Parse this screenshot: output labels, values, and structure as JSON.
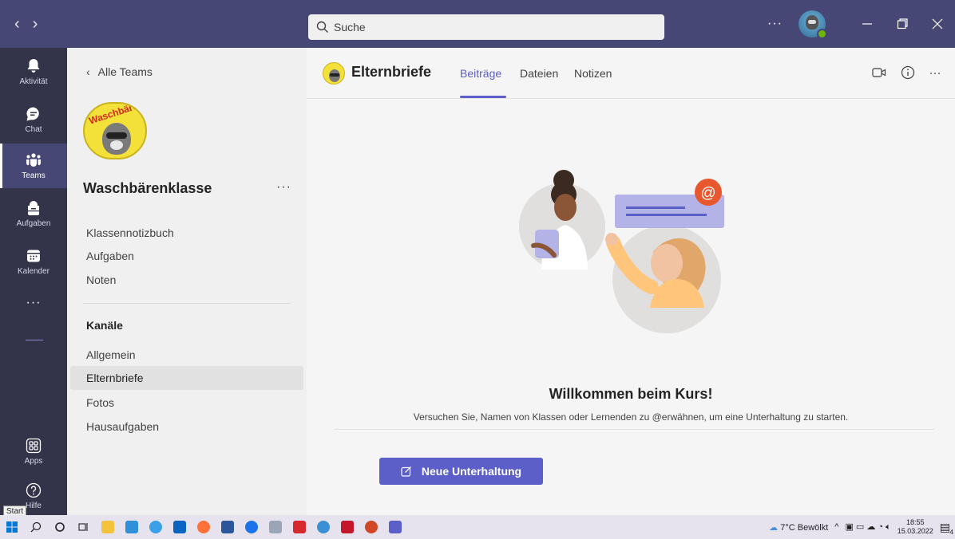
{
  "titlebar": {
    "search_placeholder": "Suche",
    "more_label": "···"
  },
  "rail": {
    "items": [
      {
        "label": "Aktivität",
        "icon": "bell-icon"
      },
      {
        "label": "Chat",
        "icon": "chat-icon"
      },
      {
        "label": "Teams",
        "icon": "teams-icon",
        "active": true
      },
      {
        "label": "Aufgaben",
        "icon": "assignments-icon"
      },
      {
        "label": "Kalender",
        "icon": "calendar-icon"
      }
    ],
    "more_label": "···",
    "apps_label": "Apps",
    "help_label": "Hilfe",
    "start_tooltip": "Start"
  },
  "team_pane": {
    "back_label": "Alle Teams",
    "logo_text": "Waschbären",
    "team_name": "Waschbärenklasse",
    "more_label": "···",
    "links": [
      "Klassennotizbuch",
      "Aufgaben",
      "Noten"
    ],
    "channels_heading": "Kanäle",
    "channels": [
      "Allgemein",
      "Elternbriefe",
      "Fotos",
      "Hausaufgaben"
    ],
    "selected_channel": "Elternbriefe"
  },
  "channel": {
    "title": "Elternbriefe",
    "tabs": [
      "Beiträge",
      "Dateien",
      "Notizen"
    ],
    "active_tab": "Beiträge",
    "more_label": "···"
  },
  "welcome": {
    "title": "Willkommen beim Kurs!",
    "subtitle": "Versuchen Sie, Namen von Klassen oder Lernenden zu @erwähnen, um eine Unterhaltung zu starten.",
    "button_label": "Neue Unterhaltung"
  },
  "taskbar": {
    "weather": "7°C Bewölkt",
    "time": "18:55",
    "date": "15.03.2022",
    "notification_count": "4"
  },
  "colors": {
    "titlebar": "#464775",
    "rail": "#33344a",
    "accent": "#5b5fc7"
  }
}
